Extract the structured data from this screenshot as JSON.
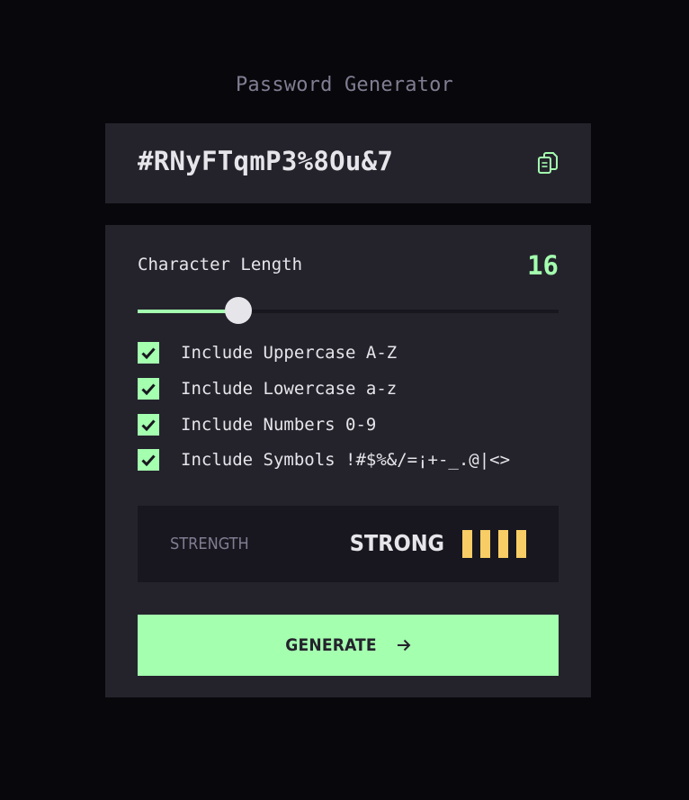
{
  "app": {
    "title": "Password Generator"
  },
  "password": {
    "value": "#RNyFTqmP3%8Ou&7",
    "copy_icon": "copy-icon"
  },
  "length": {
    "label": "Character Length",
    "value": "16",
    "slider_fraction": 0.24
  },
  "options": [
    {
      "label": "Include Uppercase A-Z",
      "checked": true
    },
    {
      "label": "Include Lowercase a-z",
      "checked": true
    },
    {
      "label": "Include Numbers 0-9",
      "checked": true
    },
    {
      "label": "Include Symbols !#$%&/=¡+-_.@|<>",
      "checked": true
    }
  ],
  "strength": {
    "label": "STRENGTH",
    "value": "STRONG",
    "level": 4,
    "max_level": 4
  },
  "generate": {
    "label": "GENERATE",
    "icon": "arrow-right-icon"
  },
  "colors": {
    "background": "#08070B",
    "panel": "#24232C",
    "accent": "#A4FFAF",
    "strength_bar": "#F8CD65",
    "text": "#E6E5EA",
    "muted": "#817D92"
  }
}
